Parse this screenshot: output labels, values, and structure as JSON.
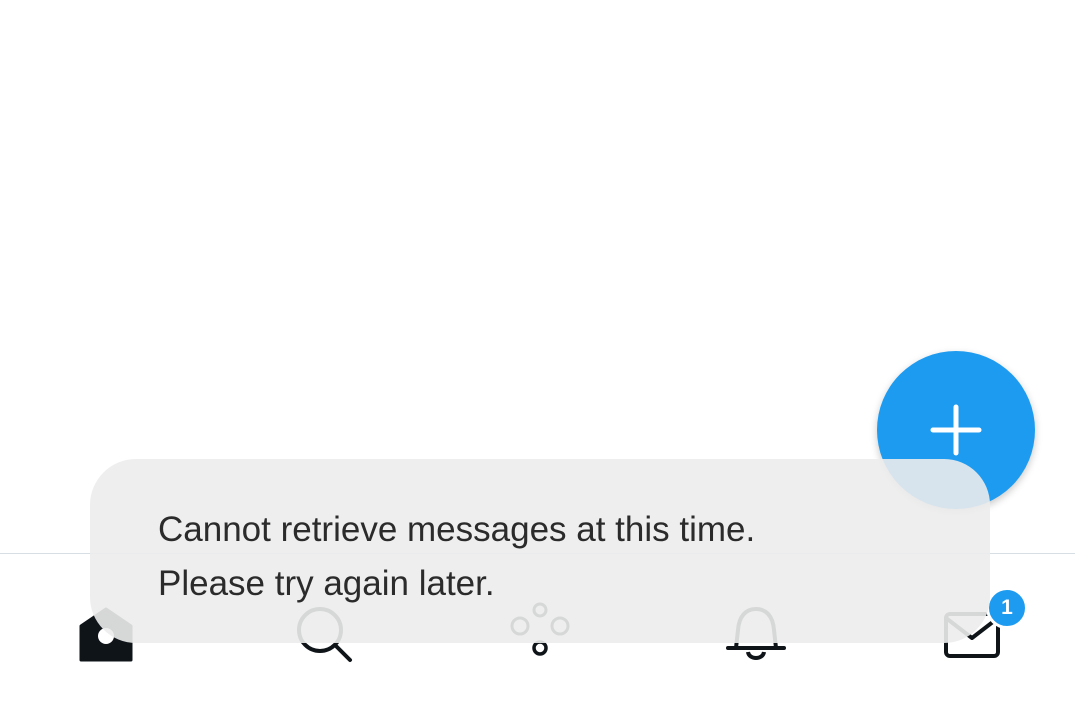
{
  "app": {
    "accent_color": "#1d9bf0"
  },
  "compose_button": {
    "icon": "plus-icon"
  },
  "toast": {
    "line1": "Cannot retrieve messages at this time.",
    "line2": "Please try again later."
  },
  "tab_bar": {
    "items": [
      {
        "id": "home",
        "icon": "home-icon",
        "active": true
      },
      {
        "id": "search",
        "icon": "search-icon",
        "active": false
      },
      {
        "id": "spaces",
        "icon": "spaces-icon",
        "active": false
      },
      {
        "id": "notifications",
        "icon": "bell-icon",
        "active": false
      },
      {
        "id": "messages",
        "icon": "envelope-icon",
        "active": false,
        "badge": "1"
      }
    ]
  }
}
